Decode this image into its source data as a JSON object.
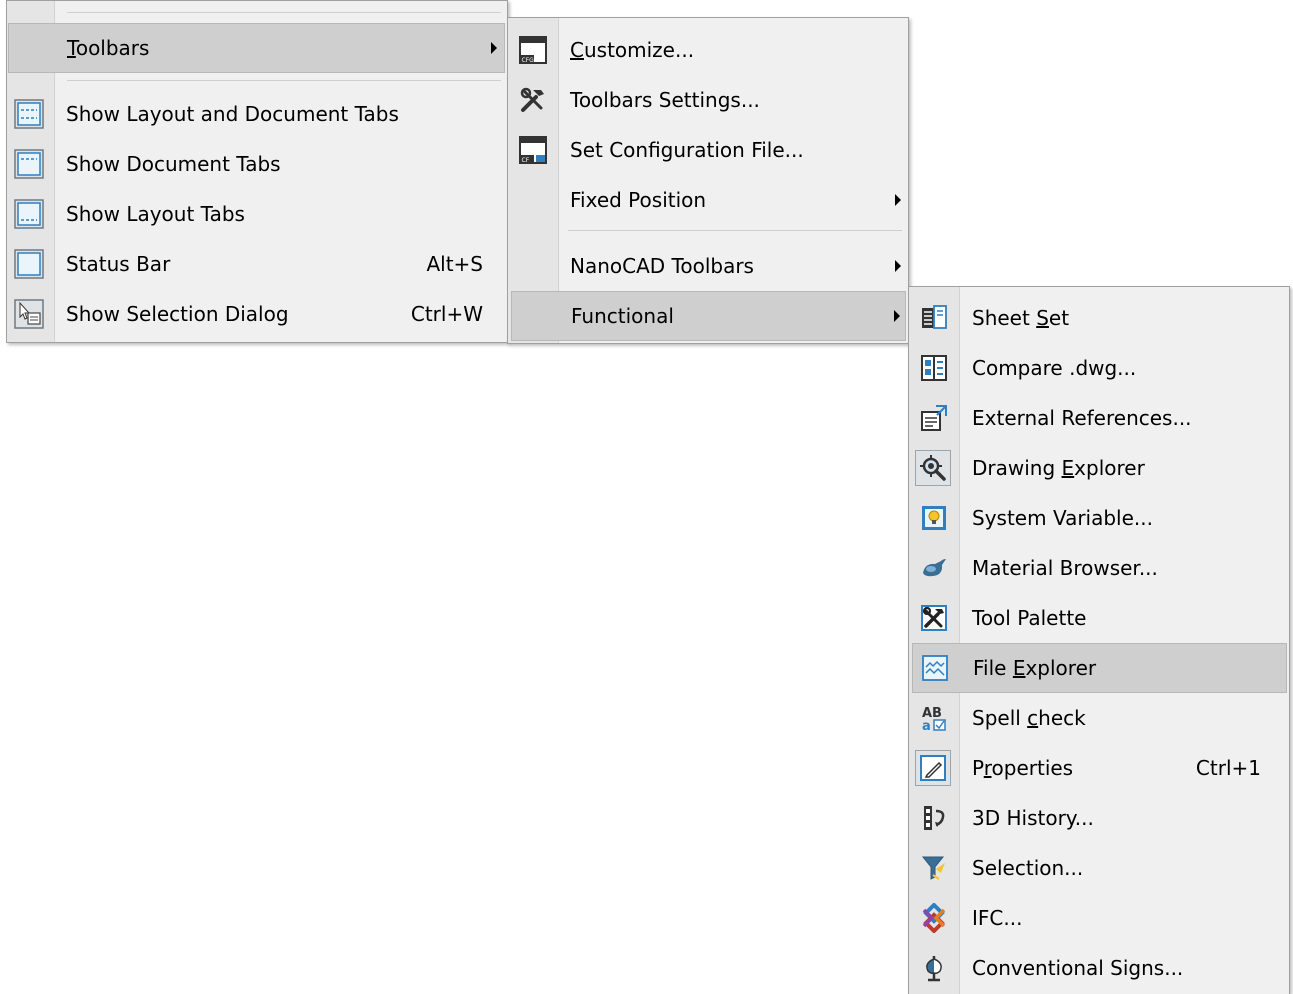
{
  "menu1": {
    "toolbars": {
      "label": "Toolbars"
    },
    "items": [
      {
        "label": "Show Layout and Document Tabs",
        "icon": "layout-document-tabs-icon",
        "shortcut": ""
      },
      {
        "label": "Show Document Tabs",
        "icon": "document-tabs-icon",
        "shortcut": ""
      },
      {
        "label": "Show Layout Tabs",
        "icon": "layout-tabs-icon",
        "shortcut": ""
      },
      {
        "label": "Status Bar",
        "icon": "status-bar-icon",
        "shortcut": "Alt+S"
      },
      {
        "label": "Show Selection Dialog",
        "icon": "selection-dialog-icon",
        "shortcut": "Ctrl+W"
      }
    ]
  },
  "menu2": {
    "items": [
      {
        "label": "Customize...",
        "icon": "customize-cfg-icon"
      },
      {
        "label": "Toolbars Settings...",
        "icon": "tools-icon"
      },
      {
        "label": "Set Configuration File...",
        "icon": "config-file-icon"
      },
      {
        "label": "Fixed Position",
        "icon": ""
      },
      {
        "label": "NanoCAD Toolbars",
        "icon": ""
      },
      {
        "label": "Functional",
        "icon": ""
      }
    ]
  },
  "menu3": {
    "items": [
      {
        "label": "Sheet Set",
        "icon": "sheet-set-icon",
        "shortcut": ""
      },
      {
        "label": "Compare .dwg...",
        "icon": "compare-dwg-icon",
        "shortcut": ""
      },
      {
        "label": "External References...",
        "icon": "external-references-icon",
        "shortcut": ""
      },
      {
        "label": "Drawing Explorer",
        "icon": "drawing-explorer-icon",
        "shortcut": ""
      },
      {
        "label": "System Variable...",
        "icon": "system-variable-icon",
        "shortcut": ""
      },
      {
        "label": "Material Browser...",
        "icon": "material-browser-icon",
        "shortcut": ""
      },
      {
        "label": "Tool Palette",
        "icon": "tool-palette-icon",
        "shortcut": ""
      },
      {
        "label": "File Explorer",
        "icon": "file-explorer-icon",
        "shortcut": ""
      },
      {
        "label": "Spell check",
        "icon": "spell-check-icon",
        "shortcut": ""
      },
      {
        "label": "Properties",
        "icon": "properties-icon",
        "shortcut": "Ctrl+1"
      },
      {
        "label": "3D History...",
        "icon": "3d-history-icon",
        "shortcut": ""
      },
      {
        "label": "Selection...",
        "icon": "selection-icon",
        "shortcut": ""
      },
      {
        "label": "IFC...",
        "icon": "ifc-icon",
        "shortcut": ""
      },
      {
        "label": "Conventional Signs...",
        "icon": "conventional-signs-icon",
        "shortcut": ""
      }
    ]
  },
  "colors": {
    "highlight": "#cfcfcf",
    "menu_bg": "#f0f0f0",
    "gutter": "#e5e5e5",
    "accent": "#2f7fc1"
  }
}
